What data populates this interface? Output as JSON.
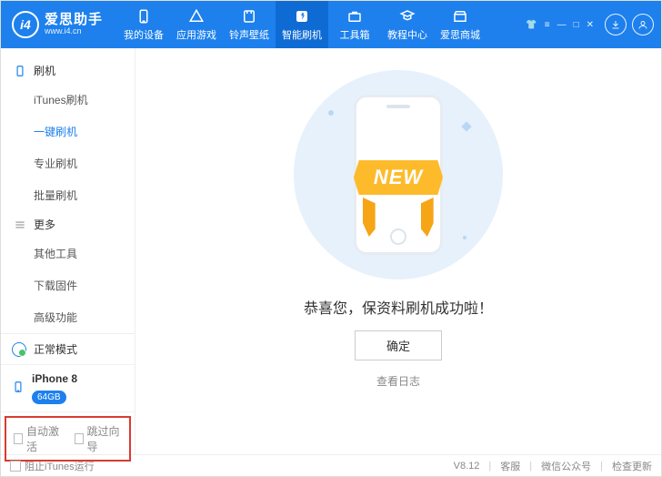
{
  "header": {
    "logo_mark": "i4",
    "app_name": "爱思助手",
    "app_url": "www.i4.cn",
    "nav": [
      {
        "label": "我的设备",
        "icon": "device"
      },
      {
        "label": "应用游戏",
        "icon": "apps"
      },
      {
        "label": "铃声壁纸",
        "icon": "ringtone"
      },
      {
        "label": "智能刷机",
        "icon": "flash",
        "active": true
      },
      {
        "label": "工具箱",
        "icon": "toolbox"
      },
      {
        "label": "教程中心",
        "icon": "tutorial"
      },
      {
        "label": "爱思商城",
        "icon": "store"
      }
    ]
  },
  "sidebar": {
    "group1": {
      "title": "刷机",
      "items": [
        "iTunes刷机",
        "一键刷机",
        "专业刷机",
        "批量刷机"
      ],
      "active_index": 1
    },
    "group2": {
      "title": "更多",
      "items": [
        "其他工具",
        "下载固件",
        "高级功能"
      ]
    },
    "mode_label": "正常模式",
    "device": {
      "name": "iPhone 8",
      "storage": "64GB"
    },
    "options": {
      "auto_activate": "自动激活",
      "skip_guide": "跳过向导"
    }
  },
  "main": {
    "ribbon_text": "NEW",
    "success_text": "恭喜您，保资料刷机成功啦！",
    "ok_label": "确定",
    "log_label": "查看日志"
  },
  "footer": {
    "block_itunes": "阻止iTunes运行",
    "version": "V8.12",
    "links": [
      "客服",
      "微信公众号",
      "检查更新"
    ]
  }
}
